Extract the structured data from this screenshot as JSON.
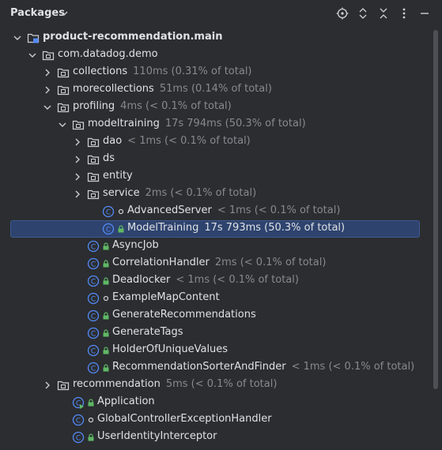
{
  "header": {
    "title": "Packages",
    "icons": [
      "chevron-down-icon",
      "crosshair-icon",
      "expand-all-icon",
      "collapse-all-icon",
      "more-icon"
    ]
  },
  "tree": [
    {
      "name": "module-product-recommendation-main",
      "label": "product-recommendation.main",
      "metric": "",
      "icon": "module",
      "arrow": "down",
      "level": 0,
      "bold": true
    },
    {
      "name": "package-com-datadog-demo",
      "label": "com.datadog.demo",
      "metric": "",
      "icon": "package",
      "arrow": "down",
      "level": 1
    },
    {
      "name": "package-collections",
      "label": "collections",
      "metric": "110ms (0.31% of total)",
      "icon": "package",
      "arrow": "right",
      "level": 2
    },
    {
      "name": "package-morecollections",
      "label": "morecollections",
      "metric": "51ms (0.14% of total)",
      "icon": "package",
      "arrow": "right",
      "level": 2
    },
    {
      "name": "package-profiling",
      "label": "profiling",
      "metric": "4ms (< 0.1% of total)",
      "icon": "package",
      "arrow": "down",
      "level": 2
    },
    {
      "name": "package-modeltraining",
      "label": "modeltraining",
      "metric": "17s 794ms (50.3% of total)",
      "icon": "package",
      "arrow": "down",
      "level": 3
    },
    {
      "name": "package-dao",
      "label": "dao",
      "metric": "< 1ms (< 0.1% of total)",
      "icon": "package",
      "arrow": "right",
      "level": 4
    },
    {
      "name": "package-ds",
      "label": "ds",
      "metric": "",
      "icon": "package",
      "arrow": "right",
      "level": 4
    },
    {
      "name": "package-entity",
      "label": "entity",
      "metric": "",
      "icon": "package",
      "arrow": "right",
      "level": 4
    },
    {
      "name": "package-service",
      "label": "service",
      "metric": "2ms (< 0.1% of total)",
      "icon": "package",
      "arrow": "right",
      "level": 4
    },
    {
      "name": "class-advancedserver",
      "label": "AdvancedServer",
      "metric": "< 1ms (< 0.1% of total)",
      "icon": "class",
      "mod": "circle",
      "level": 5
    },
    {
      "name": "class-modeltraining",
      "label": "ModelTraining",
      "metric": "17s 793ms (50.3% of total)",
      "icon": "class",
      "mod": "lock",
      "level": 5,
      "selected": true
    },
    {
      "name": "class-asyncjob",
      "label": "AsyncJob",
      "metric": "",
      "icon": "class",
      "mod": "lock",
      "level": 4
    },
    {
      "name": "class-correlationhandler",
      "label": "CorrelationHandler",
      "metric": "2ms (< 0.1% of total)",
      "icon": "class",
      "mod": "lock",
      "level": 4
    },
    {
      "name": "class-deadlocker",
      "label": "Deadlocker",
      "metric": "< 1ms (< 0.1% of total)",
      "icon": "class",
      "mod": "lock",
      "level": 4
    },
    {
      "name": "class-examplemapcontent",
      "label": "ExampleMapContent",
      "metric": "",
      "icon": "class",
      "mod": "circle",
      "level": 4
    },
    {
      "name": "class-generaterecommendations",
      "label": "GenerateRecommendations",
      "metric": "",
      "icon": "class",
      "mod": "lock",
      "level": 4
    },
    {
      "name": "class-generatetags",
      "label": "GenerateTags",
      "metric": "",
      "icon": "class",
      "mod": "lock",
      "level": 4
    },
    {
      "name": "class-holderofuniquevalues",
      "label": "HolderOfUniqueValues",
      "metric": "",
      "icon": "class",
      "mod": "lock",
      "level": 4
    },
    {
      "name": "class-recommendationsorterandfinder",
      "label": "RecommendationSorterAndFinder",
      "metric": "< 1ms (< 0.1% of total)",
      "icon": "class",
      "mod": "lock",
      "level": 4
    },
    {
      "name": "package-recommendation",
      "label": "recommendation",
      "metric": "5ms (< 0.1% of total)",
      "icon": "package",
      "arrow": "right",
      "level": 2
    },
    {
      "name": "class-application",
      "label": "Application",
      "metric": "",
      "icon": "app-class",
      "mod": "lock",
      "level": 3
    },
    {
      "name": "class-globalcontrollerexceptionhandler",
      "label": "GlobalControllerExceptionHandler",
      "metric": "",
      "icon": "class",
      "mod": "circle",
      "level": 3
    },
    {
      "name": "class-useridentityinterceptor",
      "label": "UserIdentityInterceptor",
      "metric": "",
      "icon": "class",
      "mod": "lock",
      "level": 3
    }
  ],
  "colors": {
    "background": "#2b2d30",
    "selection": "#2e436e",
    "text": "#dfe1e5",
    "metric": "#868a91",
    "class_icon": "#548af7",
    "lock": "#5fb865"
  }
}
